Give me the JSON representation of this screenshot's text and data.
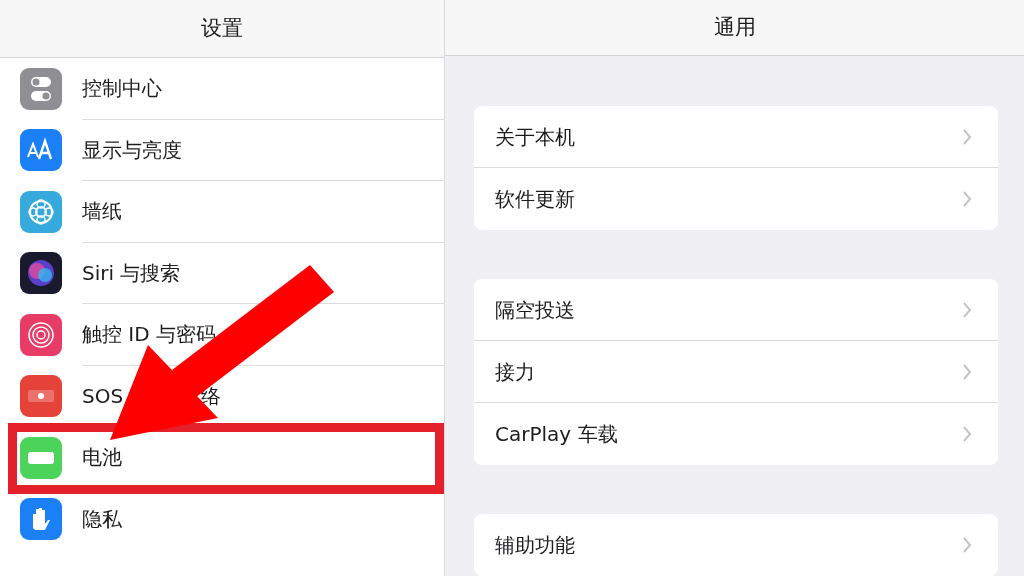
{
  "sidebar": {
    "title": "设置",
    "items": [
      {
        "label": "控制中心"
      },
      {
        "label": "显示与亮度"
      },
      {
        "label": "墙纸"
      },
      {
        "label": "Siri 与搜索"
      },
      {
        "label": "触控 ID 与密码"
      },
      {
        "label": "SOS",
        "label_tail": "络"
      },
      {
        "label": "电池"
      },
      {
        "label": "隐私"
      }
    ]
  },
  "detail": {
    "title": "通用",
    "groups": [
      {
        "rows": [
          {
            "label": "关于本机"
          },
          {
            "label": "软件更新"
          }
        ]
      },
      {
        "rows": [
          {
            "label": "隔空投送"
          },
          {
            "label": "接力"
          },
          {
            "label": "CarPlay 车载"
          }
        ]
      },
      {
        "rows": [
          {
            "label": "辅助功能"
          }
        ]
      }
    ]
  }
}
